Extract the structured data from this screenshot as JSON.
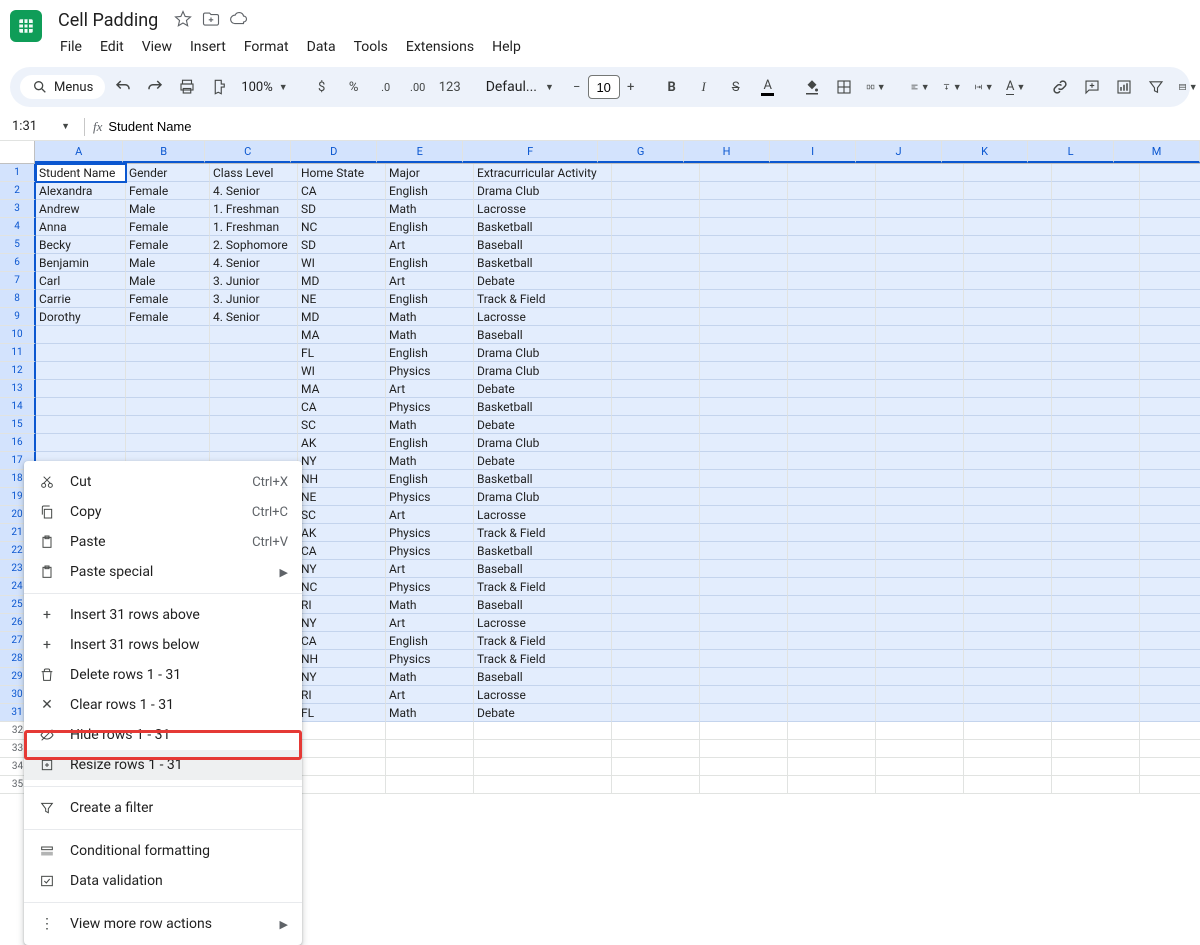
{
  "doc_title": "Cell Padding",
  "menus": [
    "File",
    "Edit",
    "View",
    "Insert",
    "Format",
    "Data",
    "Tools",
    "Extensions",
    "Help"
  ],
  "search_label": "Menus",
  "zoom": "100%",
  "currency": "$",
  "percent": "%",
  "dec_dec": ".0",
  "inc_dec": ".00",
  "num_fmt": "123",
  "font_name": "Defaul...",
  "font_size": "10",
  "name_box": "1:31",
  "fx_value": "Student Name",
  "columns": [
    "A",
    "B",
    "C",
    "D",
    "E",
    "F",
    "G",
    "H",
    "I",
    "J",
    "K",
    "L",
    "M"
  ],
  "sel_cols": [
    "A",
    "B",
    "C",
    "D",
    "E",
    "F",
    "G",
    "H",
    "I",
    "J",
    "K",
    "L",
    "M"
  ],
  "sel_rows": [
    1,
    2,
    3,
    4,
    5,
    6,
    7,
    8,
    9,
    10,
    11,
    12,
    13,
    14,
    15,
    16,
    17,
    18,
    19,
    20,
    21,
    22,
    23,
    24,
    25,
    26,
    27,
    28,
    29,
    30,
    31
  ],
  "num_rows": 35,
  "data": [
    [
      "Student Name",
      "Gender",
      "",
      "Class Level",
      "",
      "Home State",
      "",
      "Major",
      "",
      "Extracurricular Activity"
    ],
    [
      "Alexandra",
      "Female",
      "",
      "4. Senior",
      "",
      "CA",
      "",
      "English",
      "",
      "Drama Club"
    ],
    [
      "Andrew",
      "Male",
      "",
      "1. Freshman",
      "",
      "SD",
      "",
      "Math",
      "",
      "Lacrosse"
    ],
    [
      "Anna",
      "Female",
      "",
      "1. Freshman",
      "",
      "NC",
      "",
      "English",
      "",
      "Basketball"
    ],
    [
      "Becky",
      "Female",
      "",
      "2. Sophomore",
      "",
      "SD",
      "",
      "Art",
      "",
      "Baseball"
    ],
    [
      "Benjamin",
      "Male",
      "",
      "4. Senior",
      "",
      "WI",
      "",
      "English",
      "",
      "Basketball"
    ],
    [
      "Carl",
      "Male",
      "",
      "3. Junior",
      "",
      "MD",
      "",
      "Art",
      "",
      "Debate"
    ],
    [
      "Carrie",
      "Female",
      "",
      "3. Junior",
      "",
      "NE",
      "",
      "English",
      "",
      "Track & Field"
    ],
    [
      "Dorothy",
      "Female",
      "",
      "4. Senior",
      "",
      "MD",
      "",
      "Math",
      "",
      "Lacrosse"
    ],
    [
      "",
      "",
      "",
      "",
      "",
      "MA",
      "",
      "Math",
      "",
      "Baseball"
    ],
    [
      "",
      "",
      "",
      "",
      "",
      "FL",
      "",
      "English",
      "",
      "Drama Club"
    ],
    [
      "",
      "",
      "",
      "",
      "",
      "WI",
      "",
      "Physics",
      "",
      "Drama Club"
    ],
    [
      "",
      "",
      "",
      "",
      "",
      "MA",
      "",
      "Art",
      "",
      "Debate"
    ],
    [
      "",
      "",
      "",
      "",
      "",
      "CA",
      "",
      "Physics",
      "",
      "Basketball"
    ],
    [
      "",
      "",
      "",
      "",
      "",
      "SC",
      "",
      "Math",
      "",
      "Debate"
    ],
    [
      "",
      "",
      "",
      "",
      "",
      "AK",
      "",
      "English",
      "",
      "Drama Club"
    ],
    [
      "",
      "",
      "",
      "",
      "",
      "NY",
      "",
      "Math",
      "",
      "Debate"
    ],
    [
      "",
      "",
      "",
      "",
      "",
      "NH",
      "",
      "English",
      "",
      "Basketball"
    ],
    [
      "",
      "",
      "",
      "",
      "",
      "NE",
      "",
      "Physics",
      "",
      "Drama Club"
    ],
    [
      "",
      "",
      "",
      "",
      "",
      "SC",
      "",
      "Art",
      "",
      "Lacrosse"
    ],
    [
      "",
      "",
      "",
      "",
      "",
      "AK",
      "",
      "Physics",
      "",
      "Track & Field"
    ],
    [
      "",
      "",
      "",
      "",
      "",
      "CA",
      "",
      "Physics",
      "",
      "Basketball"
    ],
    [
      "",
      "",
      "",
      "",
      "",
      "NY",
      "",
      "Art",
      "",
      "Baseball"
    ],
    [
      "",
      "",
      "",
      "",
      "",
      "NC",
      "",
      "Physics",
      "",
      "Track & Field"
    ],
    [
      "",
      "",
      "",
      "",
      "",
      "RI",
      "",
      "Math",
      "",
      "Baseball"
    ],
    [
      "",
      "",
      "",
      "",
      "",
      "NY",
      "",
      "Art",
      "",
      "Lacrosse"
    ],
    [
      "",
      "",
      "",
      "",
      "",
      "CA",
      "",
      "English",
      "",
      "Track & Field"
    ],
    [
      "",
      "",
      "",
      "",
      "",
      "NH",
      "",
      "Physics",
      "",
      "Track & Field"
    ],
    [
      "",
      "",
      "",
      "",
      "",
      "NY",
      "",
      "Math",
      "",
      "Baseball"
    ],
    [
      "",
      "",
      "",
      "",
      "",
      "RI",
      "",
      "Art",
      "",
      "Lacrosse"
    ],
    [
      "",
      "",
      "",
      "",
      "",
      "FL",
      "",
      "Math",
      "",
      "Debate"
    ]
  ],
  "context_menu": {
    "cut": "Cut",
    "cut_sc": "Ctrl+X",
    "copy": "Copy",
    "copy_sc": "Ctrl+C",
    "paste": "Paste",
    "paste_sc": "Ctrl+V",
    "paste_special": "Paste special",
    "insert_above": "Insert 31 rows above",
    "insert_below": "Insert 31 rows below",
    "delete_rows": "Delete rows 1 - 31",
    "clear_rows": "Clear rows 1 - 31",
    "hide_rows": "Hide rows 1 - 31",
    "resize_rows": "Resize rows 1 - 31",
    "create_filter": "Create a filter",
    "cond_fmt": "Conditional formatting",
    "data_val": "Data validation",
    "more": "View more row actions"
  }
}
